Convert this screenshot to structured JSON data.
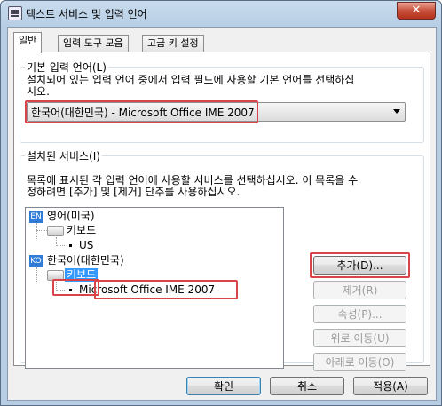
{
  "window": {
    "title": "텍스트 서비스 및 입력 언어",
    "close_label": "✕"
  },
  "tabs": [
    "일반",
    "입력 도구 모음",
    "고급 키 설정"
  ],
  "default_language": {
    "legend": "기본 입력 언어(L)",
    "description_line1": "설치되어 있는 입력 언어 중에서 입력 필드에 사용할 기본 언어를 선택하십",
    "description_line2": "시오.",
    "selected": "한국어(대한민국) - Microsoft Office IME 2007"
  },
  "installed_services": {
    "legend": "설치된 서비스(I)",
    "description_line1": "목록에 표시된 각 입력 언어에 사용할 서비스를 선택하십시오. 이 목록을 수",
    "description_line2": "정하려면 [추가] 및 [제거] 단추를 사용하십시오.",
    "tree": {
      "lang1_code": "EN",
      "lang1_name": "영어(미국)",
      "lang1_keyboard": "키보드",
      "lang1_service": "US",
      "lang2_code": "KO",
      "lang2_name": "한국어(대한민국)",
      "lang2_keyboard": "키보드",
      "lang2_service": "Microsoft Office IME 2007"
    },
    "buttons": {
      "add": "추가(D)...",
      "remove": "제거(R)",
      "properties": "속성(P)...",
      "move_up": "위로 이동(U)",
      "move_down": "아래로 이동(O)"
    }
  },
  "footer": {
    "ok": "확인",
    "cancel": "취소",
    "apply": "적용(A)"
  },
  "colors": {
    "highlight": "#d9444b",
    "selection": "#3399ff"
  }
}
